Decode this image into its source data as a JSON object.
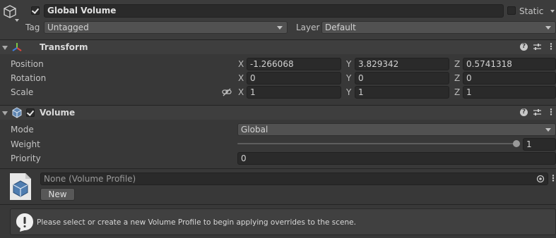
{
  "gameobject": {
    "name": "Global Volume",
    "active_checked": true,
    "static_label": "Static",
    "static_checked": false,
    "tag_label": "Tag",
    "tag_value": "Untagged",
    "layer_label": "Layer",
    "layer_value": "Default"
  },
  "transform": {
    "title": "Transform",
    "position_label": "Position",
    "rotation_label": "Rotation",
    "scale_label": "Scale",
    "axis_x": "X",
    "axis_y": "Y",
    "axis_z": "Z",
    "position": {
      "x": "-1.266068",
      "y": "3.829342",
      "z": "0.5741318"
    },
    "rotation": {
      "x": "0",
      "y": "0",
      "z": "0"
    },
    "scale": {
      "x": "1",
      "y": "1",
      "z": "1"
    }
  },
  "volume": {
    "title": "Volume",
    "enabled": true,
    "mode_label": "Mode",
    "mode_value": "Global",
    "weight_label": "Weight",
    "weight_value": "1",
    "weight_fraction": 1.0,
    "priority_label": "Priority",
    "priority_value": "0",
    "profile_value": "None (Volume Profile)",
    "new_button": "New",
    "help_message": "Please select or create a new Volume Profile to begin applying overrides to the scene."
  },
  "icons": {
    "gameobject": "cube-icon",
    "transform": "transform-axes-icon",
    "volume": "volume-cube-icon",
    "help": "help-icon",
    "presets": "presets-icon",
    "more": "kebab-menu-icon",
    "object_picker": "object-picker-icon",
    "info": "exclamation-bubble-icon",
    "scale_link": "constrain-proportions-icon"
  },
  "colors": {
    "background": "#383838",
    "field": "#2a2a2a",
    "header": "#3e3e3e",
    "help_box": "#404040"
  }
}
